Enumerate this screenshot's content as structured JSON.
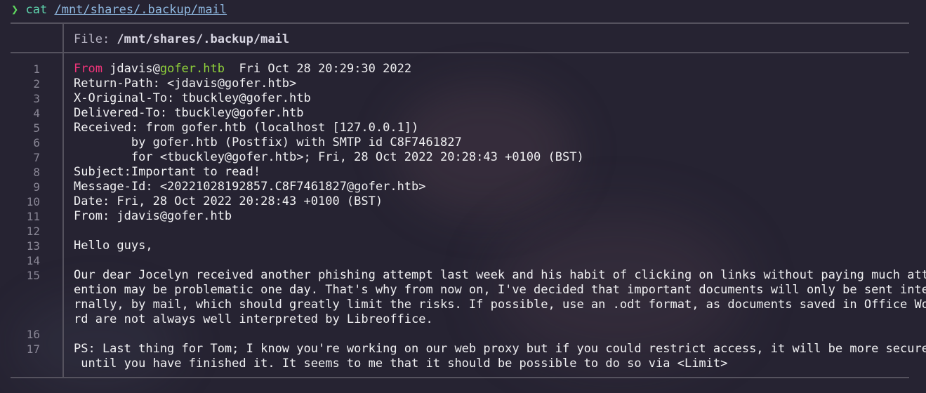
{
  "prompt": {
    "arrow": "❯",
    "command": "cat",
    "path": "/mnt/shares/.backup/mail"
  },
  "header": {
    "label": "File: ",
    "filename": "/mnt/shares/.backup/mail"
  },
  "line_numbers": [
    "1",
    "2",
    "3",
    "4",
    "5",
    "6",
    "7",
    "8",
    "9",
    "10",
    "11",
    "12",
    "13",
    "14",
    "15",
    "16",
    "17"
  ],
  "lines": {
    "l1_from": "From",
    "l1_user": " jdavis@",
    "l1_host": "gofer.htb",
    "l1_date": "  Fri Oct 28 20:29:30 2022",
    "l2": "Return-Path: <jdavis@gofer.htb>",
    "l3": "X-Original-To: tbuckley@gofer.htb",
    "l4": "Delivered-To: tbuckley@gofer.htb",
    "l5": "Received: from gofer.htb (localhost [127.0.0.1])",
    "l6": "        by gofer.htb (Postfix) with SMTP id C8F7461827",
    "l7": "        for <tbuckley@gofer.htb>; Fri, 28 Oct 2022 20:28:43 +0100 (BST)",
    "l8": "Subject:Important to read!",
    "l9": "Message-Id: <20221028192857.C8F7461827@gofer.htb>",
    "l10": "Date: Fri, 28 Oct 2022 20:28:43 +0100 (BST)",
    "l11": "From: jdavis@gofer.htb",
    "l12": "",
    "l13": "Hello guys,",
    "l14": "",
    "l15a": "Our dear Jocelyn received another phishing attempt last week and his habit of clicking on links without paying much att",
    "l15b": "ention may be problematic one day. That's why from now on, I've decided that important documents will only be sent inte",
    "l15c": "rnally, by mail, which should greatly limit the risks. If possible, use an .odt format, as documents saved in Office Wo",
    "l15d": "rd are not always well interpreted by Libreoffice.",
    "l16": "",
    "l17a": "PS: Last thing for Tom; I know you're working on our web proxy but if you could restrict access, it will be more secure",
    "l17b": " until you have finished it. It seems to me that it should be possible to do so via <Limit>"
  },
  "colors": {
    "background": "#262332",
    "from_keyword": "#f0347a",
    "host_highlight": "#8fd13a",
    "prompt_arrow": "#5fd75f"
  }
}
